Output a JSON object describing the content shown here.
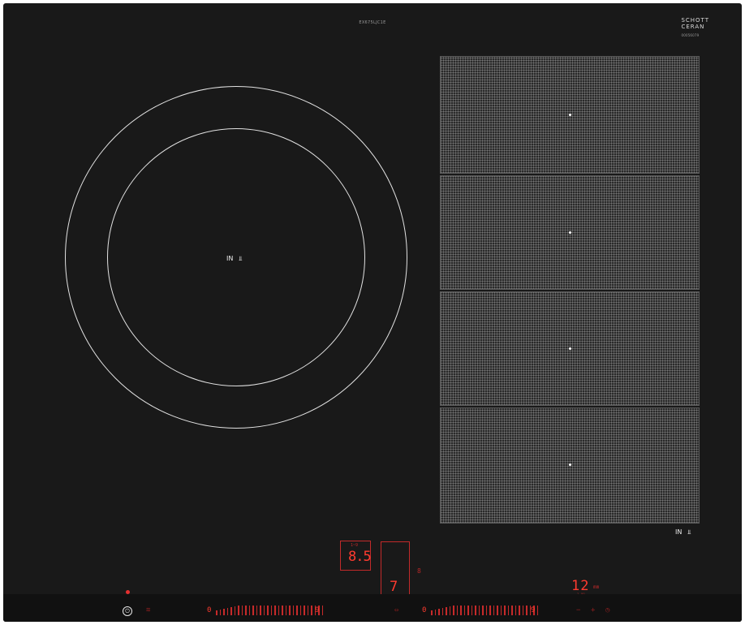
{
  "appliance": {
    "model_label": "EX675LJC1E",
    "brand_line1": "SCHOTT",
    "brand_line2": "CERAN",
    "brand_code": "00056079"
  },
  "zones": {
    "round_label": "IN",
    "flex_label": "IN"
  },
  "controls": {
    "timer_display": "8.5",
    "timer_caption": "1~9",
    "power_level": "7",
    "side_value": "8",
    "duration_value": "12",
    "duration_unit": "mm",
    "duration_caption": "1~99",
    "slider_left_start": "0",
    "slider_left_end": "9",
    "slider_right_start": "0",
    "slider_right_end": "9"
  }
}
